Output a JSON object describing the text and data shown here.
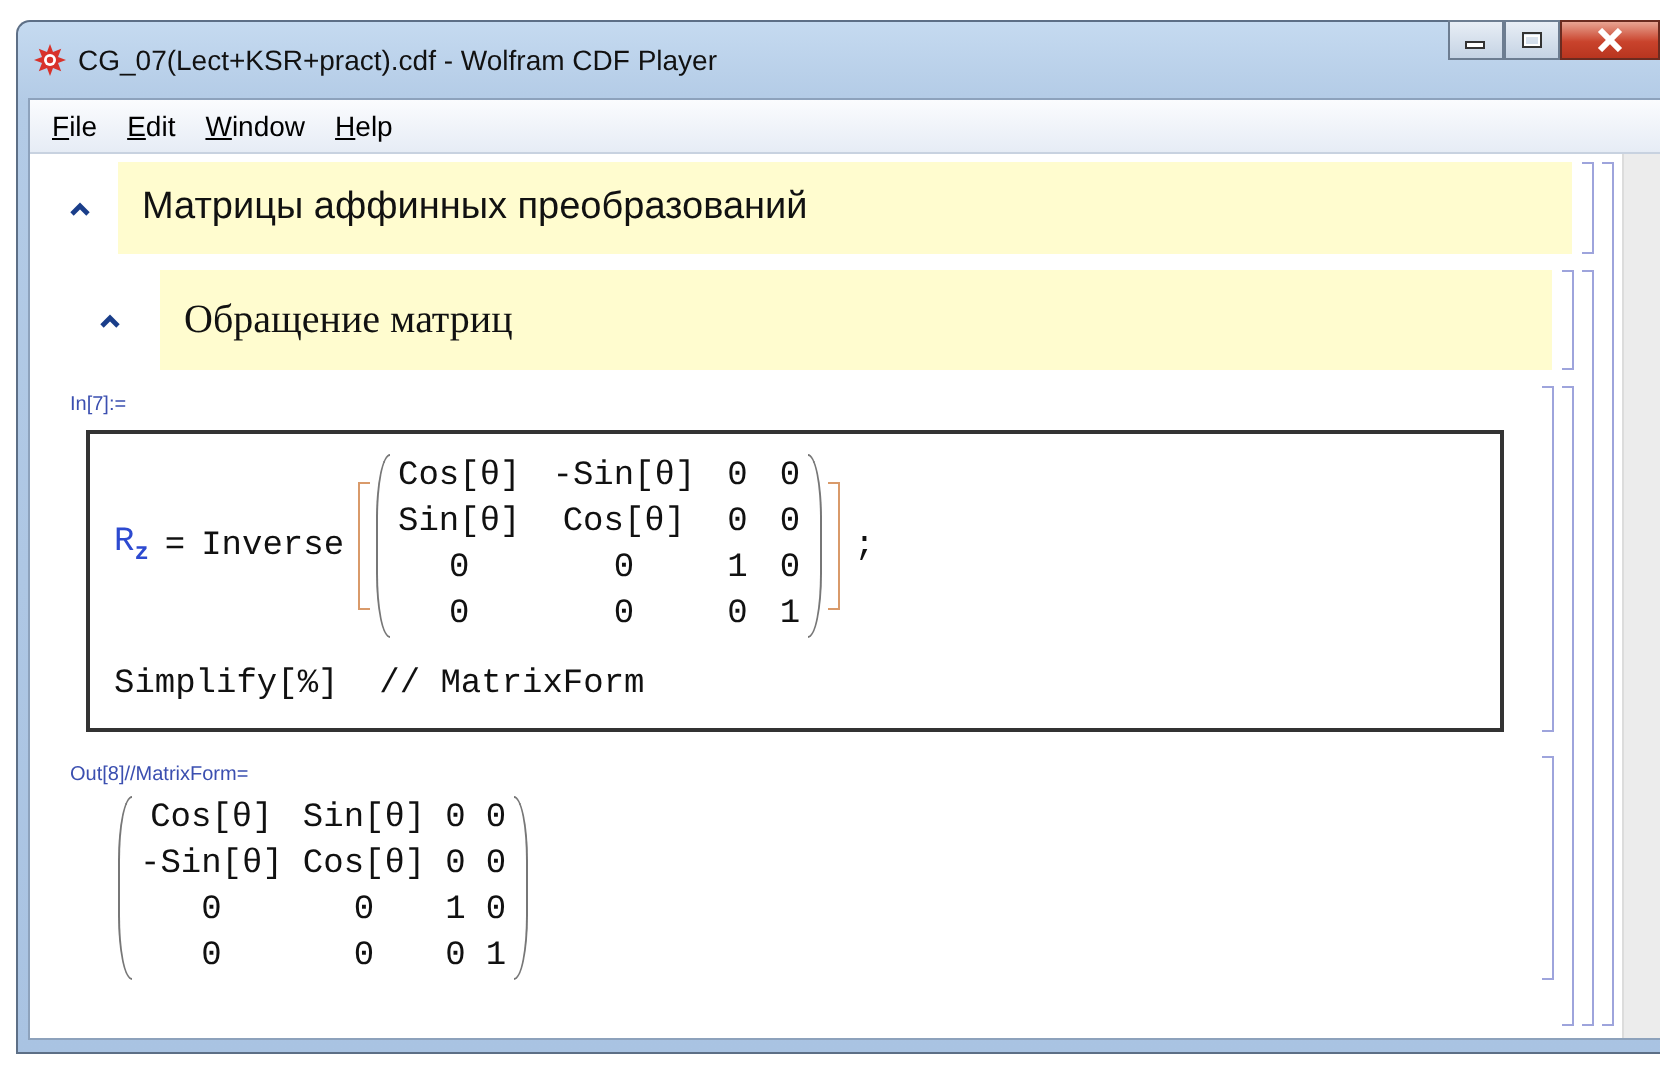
{
  "window": {
    "title": "CG_07(Lect+KSR+pract).cdf - Wolfram CDF Player"
  },
  "menu": [
    {
      "label": "File"
    },
    {
      "label": "Edit"
    },
    {
      "label": "Window"
    },
    {
      "label": "Help"
    }
  ],
  "section": {
    "title": "Матрицы аффинных преобразований",
    "expanded": true,
    "subsection": {
      "title": "Обращение матриц",
      "expanded": true,
      "input": {
        "label": "In[7]:=",
        "symbol": "R",
        "subscript": "z",
        "equals": "=",
        "function": "Inverse",
        "terminator": ";",
        "matrix": [
          [
            "Cos[θ]",
            "-Sin[θ]",
            "0",
            "0"
          ],
          [
            "Sin[θ]",
            "Cos[θ]",
            "0",
            "0"
          ],
          [
            "0",
            "0",
            "1",
            "0"
          ],
          [
            "0",
            "0",
            "0",
            "1"
          ]
        ],
        "line2": "Simplify[%]  // MatrixForm"
      },
      "output": {
        "label": "Out[8]//MatrixForm=",
        "matrix": [
          [
            "Cos[θ]",
            "Sin[θ]",
            "0",
            "0"
          ],
          [
            "-Sin[θ]",
            "Cos[θ]",
            "0",
            "0"
          ],
          [
            "0",
            "0",
            "1",
            "0"
          ],
          [
            "0",
            "0",
            "0",
            "1"
          ]
        ]
      }
    }
  }
}
